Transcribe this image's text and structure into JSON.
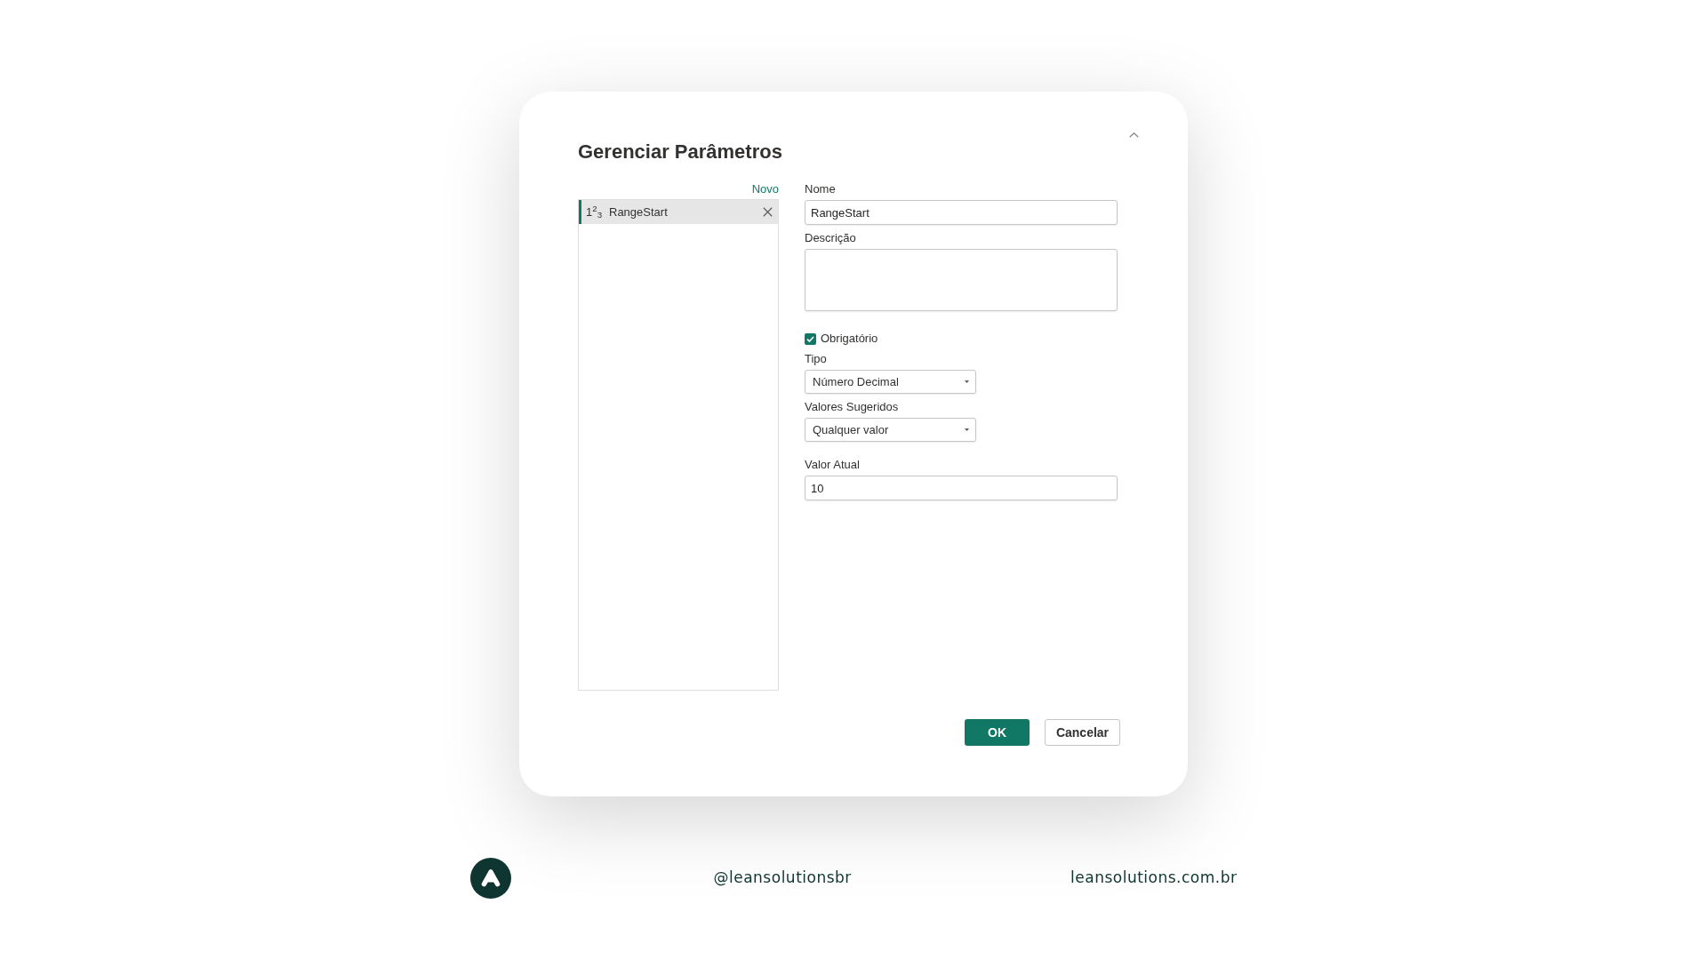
{
  "dialog": {
    "title": "Gerenciar Parâmetros",
    "new_link": "Novo",
    "parameters": [
      {
        "type_glyph": "1$^{2}$$_{3}$",
        "name": "RangeStart",
        "selected": true
      }
    ],
    "fields": [
      {
        "kind": "text",
        "label": "Nome",
        "value": "RangeStart"
      },
      {
        "kind": "textarea",
        "label": "Descrição"
      },
      {
        "kind": "checkbox",
        "label": "Obrigatório",
        "checked": true
      },
      {
        "kind": "select",
        "label": "Tipo",
        "value": "Número Decimal"
      },
      {
        "kind": "select",
        "label": "Valores Sugeridos",
        "value": "Qualquer valor"
      },
      {
        "kind": "text",
        "label": "Valor Atual",
        "value": "10"
      }
    ],
    "buttons": [
      {
        "kind": "confirm",
        "label": "OK"
      },
      {
        "kind": "cancel",
        "label": "Cancelar"
      }
    ]
  },
  "footer": {
    "handle": "@leansolutionsbr",
    "website": "leansolutions.com.br"
  }
}
